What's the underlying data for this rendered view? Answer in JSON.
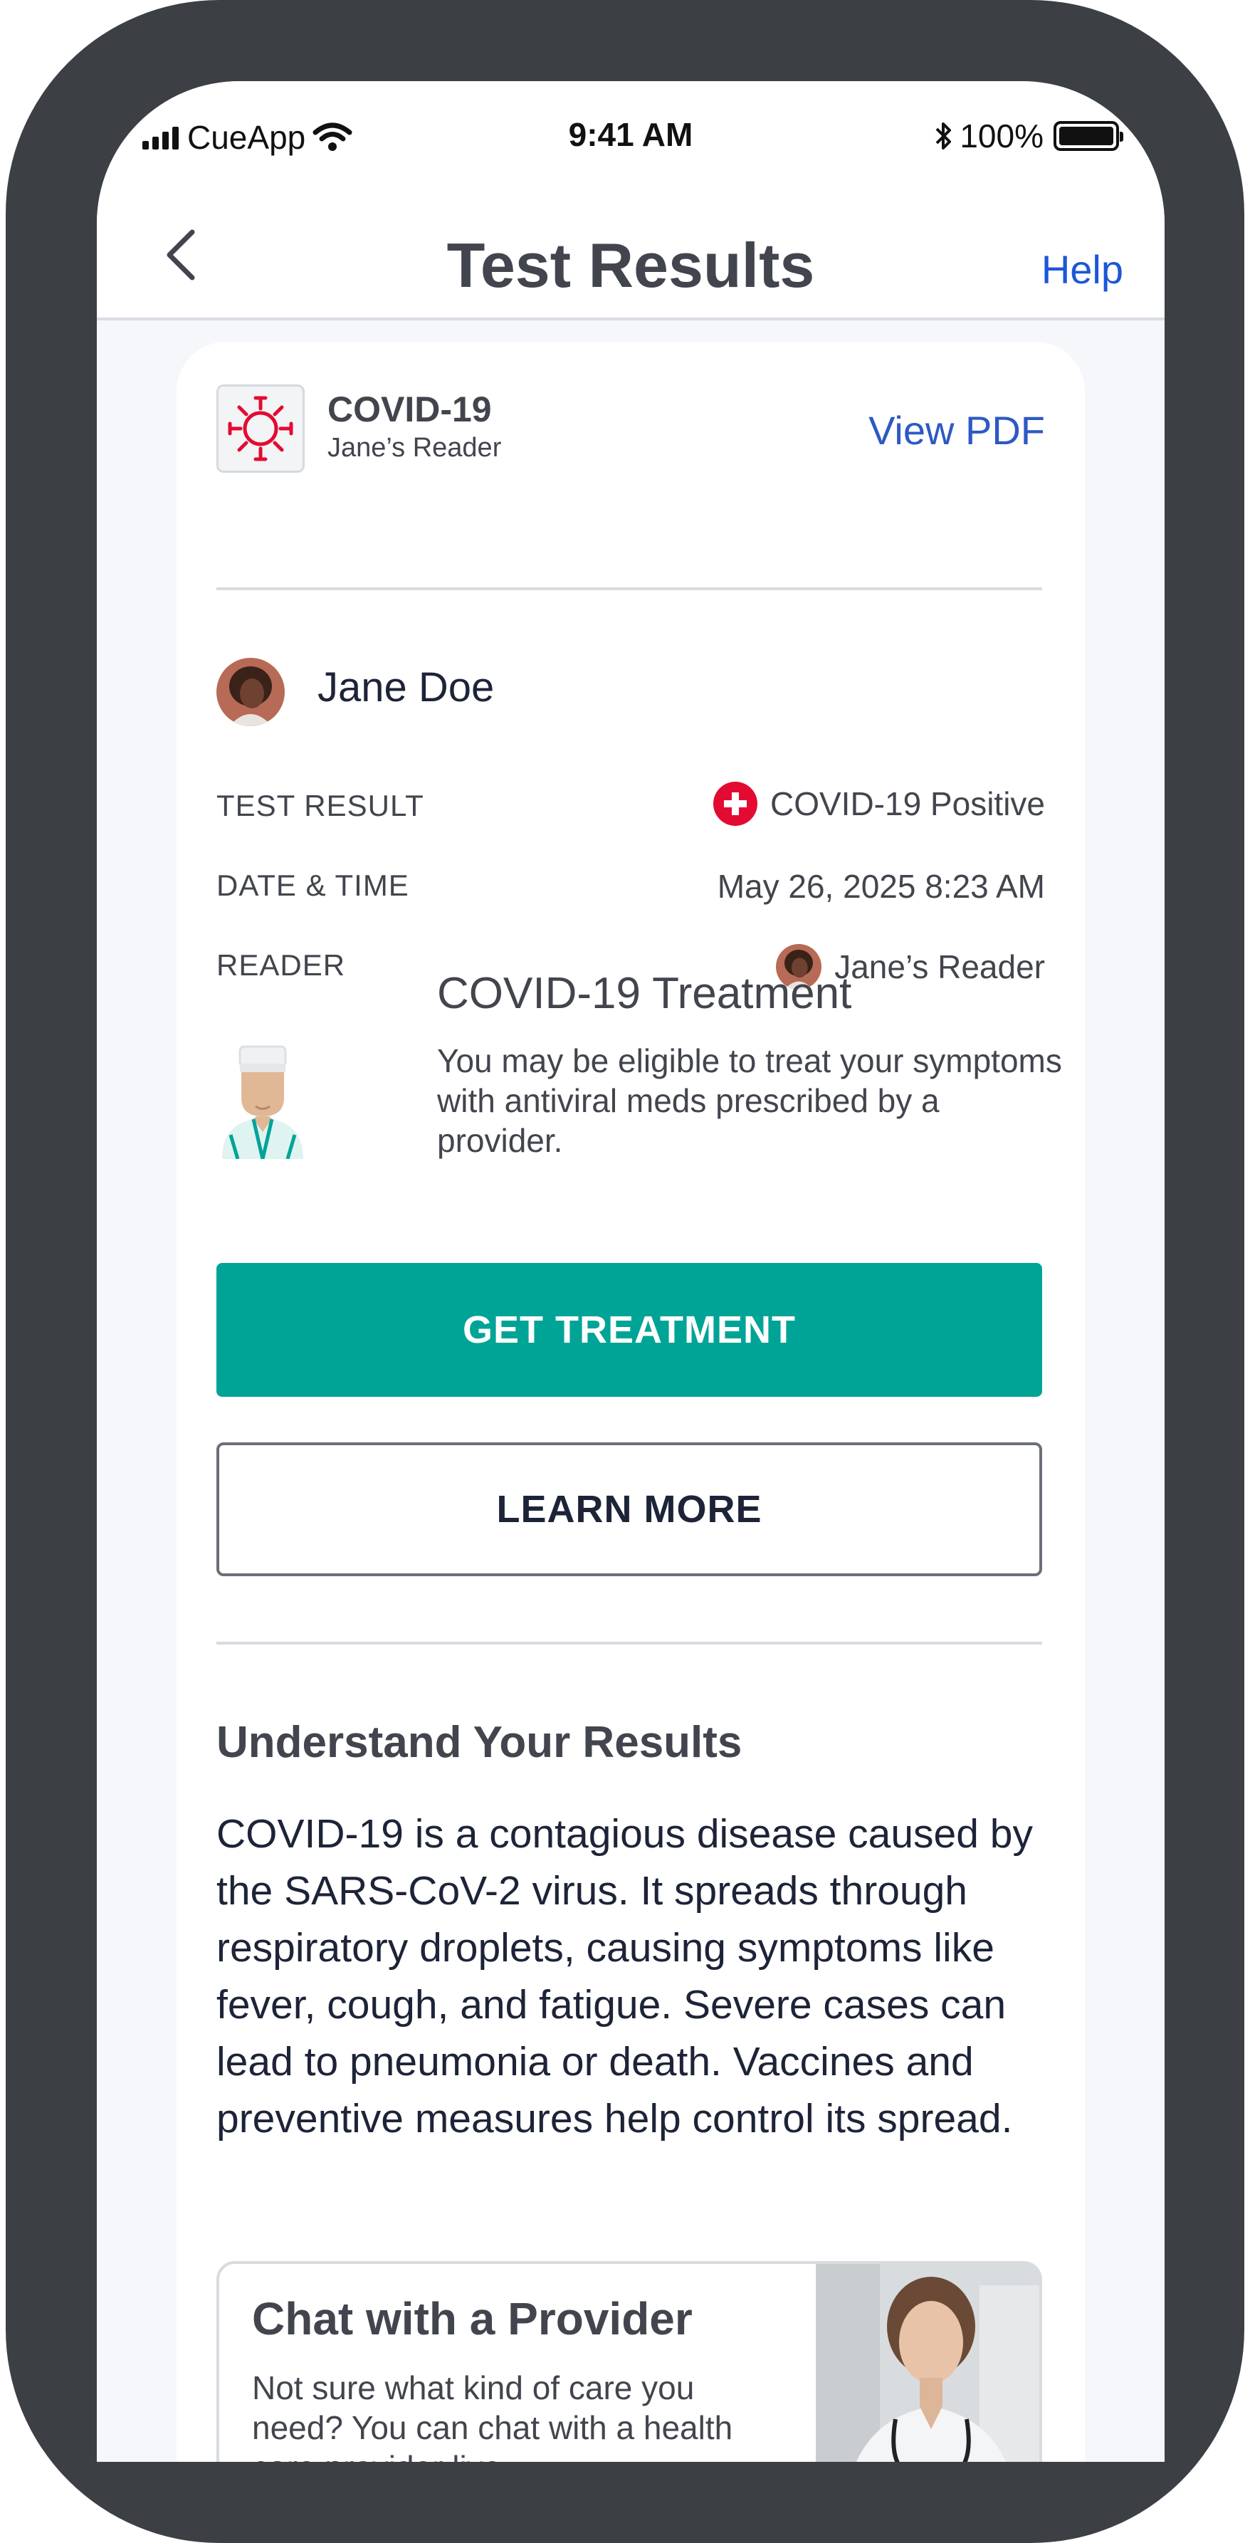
{
  "status_bar": {
    "carrier": "CueApp",
    "time": "9:41 AM",
    "battery": "100%"
  },
  "nav": {
    "title": "Test Results",
    "help_label": "Help",
    "back_icon": "chevron-left-icon"
  },
  "test": {
    "name": "COVID-19",
    "reader": "Jane’s Reader",
    "view_pdf_label": "View PDF",
    "icon": "virus-icon",
    "icon_color": "#e30b32"
  },
  "patient": {
    "name": "Jane Doe"
  },
  "details": {
    "result_label": "TEST RESULT",
    "result_value": "COVID-19 Positive",
    "result_color": "#e30b32",
    "date_label": "DATE & TIME",
    "date_value": "May 26, 2025 8:23 AM",
    "reader_label": "READER",
    "reader_value": "Jane’s Reader"
  },
  "treatment": {
    "title": "COVID-19 Treatment",
    "description": "You may be eligible to treat your symptoms with antiviral meds prescribed by a provider.",
    "get_treatment_label": "GET TREATMENT",
    "learn_more_label": "LEARN MORE",
    "accent_color": "#00a497"
  },
  "understand": {
    "title": "Understand Your Results",
    "body": "COVID-19 is a contagious disease caused by the SARS-CoV-2 virus. It spreads through respiratory droplets, causing symptoms like fever, cough, and fatigue. Severe cases can lead to pneumonia or death. Vaccines and preventive measures help control its spread."
  },
  "chat": {
    "title": "Chat with a Provider",
    "description": "Not sure what kind of care you need? You can chat with a health care provider live."
  }
}
